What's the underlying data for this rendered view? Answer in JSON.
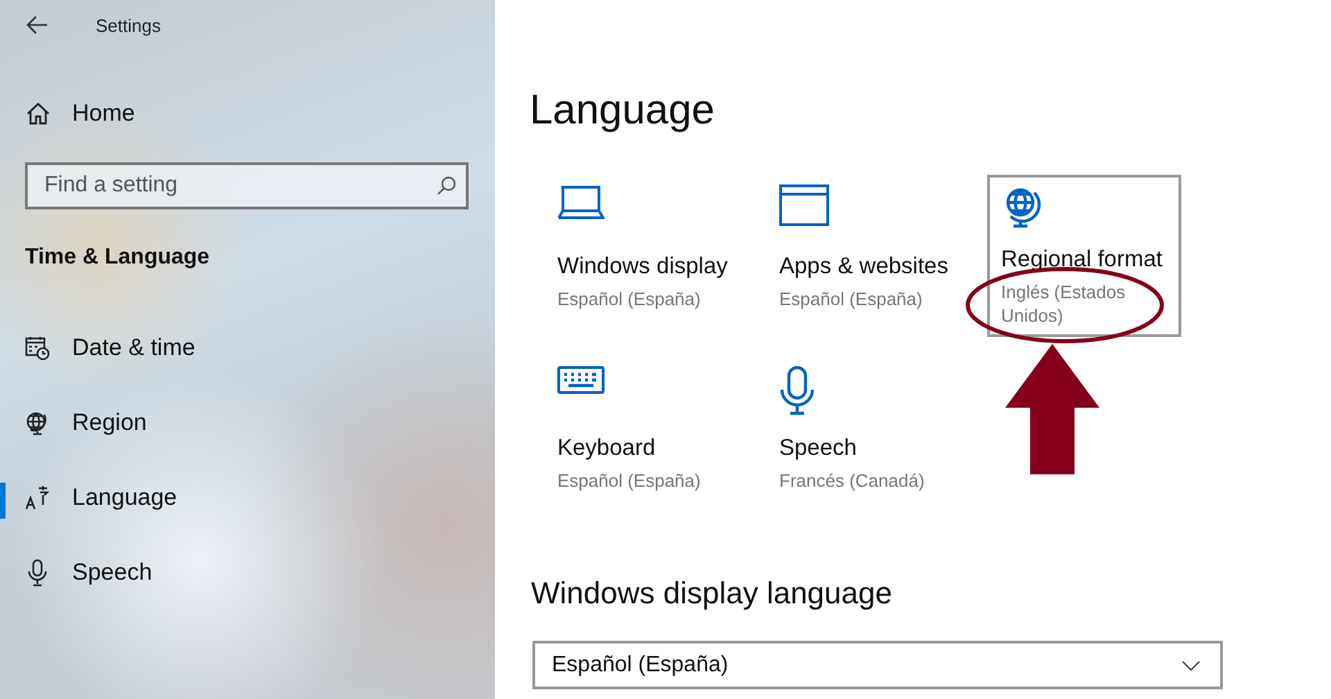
{
  "window": {
    "title": "Settings"
  },
  "sidebar": {
    "home": "Home",
    "search": {
      "placeholder": "Find a setting"
    },
    "section": "Time & Language",
    "items": [
      {
        "kind": "datetime",
        "label": "Date & time",
        "selected": false
      },
      {
        "kind": "region",
        "label": "Region",
        "selected": false
      },
      {
        "kind": "language",
        "label": "Language",
        "selected": true
      },
      {
        "kind": "speech",
        "label": "Speech",
        "selected": false
      }
    ]
  },
  "page": {
    "title": "Language",
    "tiles": [
      {
        "kind": "display",
        "title": "Windows display",
        "subtitle": "Español (España)",
        "selected": false,
        "annotated": false
      },
      {
        "kind": "apps",
        "title": "Apps & websites",
        "subtitle": "Español (España)",
        "selected": false,
        "annotated": false
      },
      {
        "kind": "regional",
        "title": "Regional format",
        "subtitle": "Inglés (Estados Unidos)",
        "selected": true,
        "annotated": true
      },
      {
        "kind": "keyboard",
        "title": "Keyboard",
        "subtitle": "Español (España)",
        "selected": false,
        "annotated": false
      },
      {
        "kind": "speech",
        "title": "Speech",
        "subtitle": "Francés (Canadá)",
        "selected": false,
        "annotated": false
      }
    ],
    "section": "Windows display language",
    "dropdown": {
      "value": "Español (España)"
    }
  }
}
